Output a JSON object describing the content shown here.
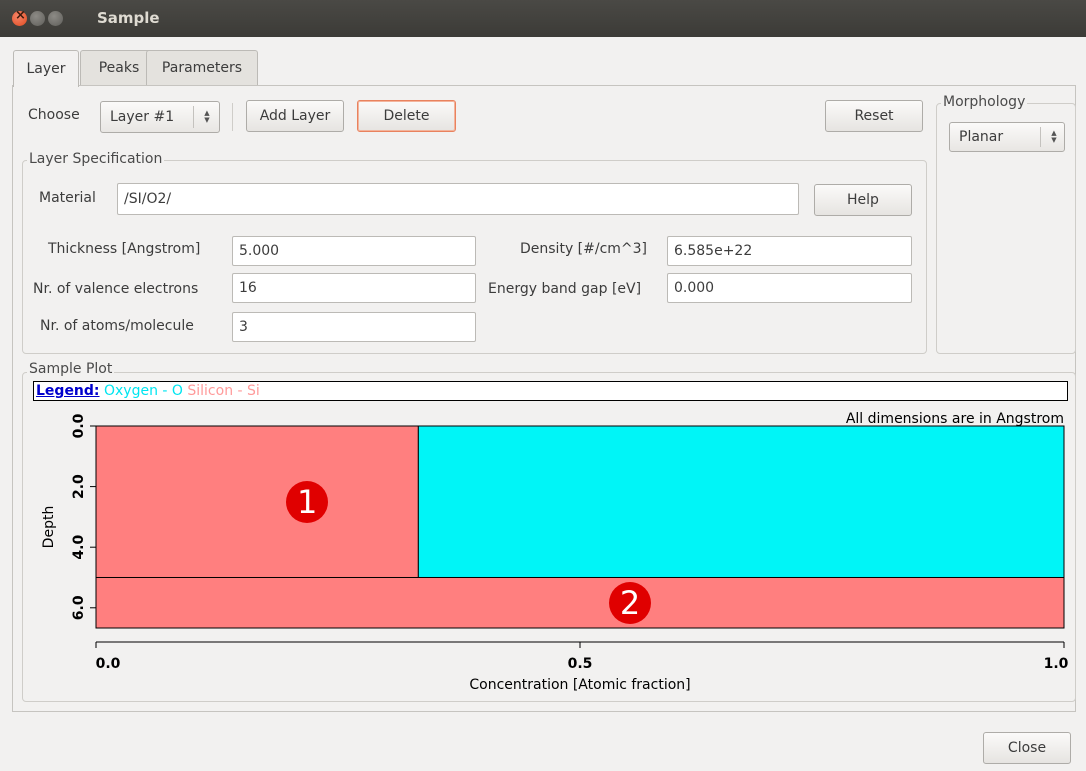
{
  "window": {
    "title": "Sample"
  },
  "tabs": [
    {
      "label": "Layer",
      "active": true
    },
    {
      "label": "Peaks",
      "active": false
    },
    {
      "label": "Parameters",
      "active": false
    }
  ],
  "layer_controls": {
    "choose_label": "Choose",
    "layer_select": "Layer #1",
    "add_layer": "Add Layer",
    "delete": "Delete",
    "reset": "Reset"
  },
  "morphology": {
    "title": "Morphology",
    "value": "Planar"
  },
  "spec": {
    "title": "Layer Specification",
    "material_label": "Material",
    "material_value": "/SI/O2/",
    "help": "Help",
    "thickness_label": "Thickness [Angstrom]",
    "thickness_value": "5.000",
    "density_label": "Density [#/cm^3]",
    "density_value": "6.585e+22",
    "valence_label": "Nr. of valence electrons",
    "valence_value": "16",
    "bandgap_label": "Energy band gap [eV]",
    "bandgap_value": "0.000",
    "atoms_label": "Nr. of atoms/molecule",
    "atoms_value": "3"
  },
  "plot": {
    "title": "Sample Plot",
    "legend_title": "Legend:",
    "legend_oxygen": "Oxygen - O",
    "legend_silicon": "Silicon - Si",
    "note": "All dimensions are in Angstrom"
  },
  "chart_data": {
    "type": "area",
    "xlabel": "Concentration [Atomic fraction]",
    "ylabel": "Depth",
    "xlim": [
      0.0,
      1.0
    ],
    "ylim": [
      0.0,
      6.667
    ],
    "x_ticks": [
      "0.0",
      "0.5",
      "1.0"
    ],
    "y_ticks": [
      "0.0",
      "2.0",
      "4.0",
      "6.0"
    ],
    "layers": [
      {
        "label": "1",
        "depth": [
          0.0,
          5.0
        ],
        "segments": [
          {
            "element": "Silicon - Si",
            "fraction": 0.333,
            "color": "#ff7f7f"
          },
          {
            "element": "Oxygen - O",
            "fraction": 0.667,
            "color": "#00f5f7"
          }
        ]
      },
      {
        "label": "2",
        "depth": [
          5.0,
          6.667
        ],
        "segments": [
          {
            "element": "Silicon - Si",
            "fraction": 1.0,
            "color": "#ff7f7f"
          }
        ]
      }
    ],
    "badge_color": "#e00000",
    "grid": false
  },
  "footer": {
    "close": "Close"
  }
}
